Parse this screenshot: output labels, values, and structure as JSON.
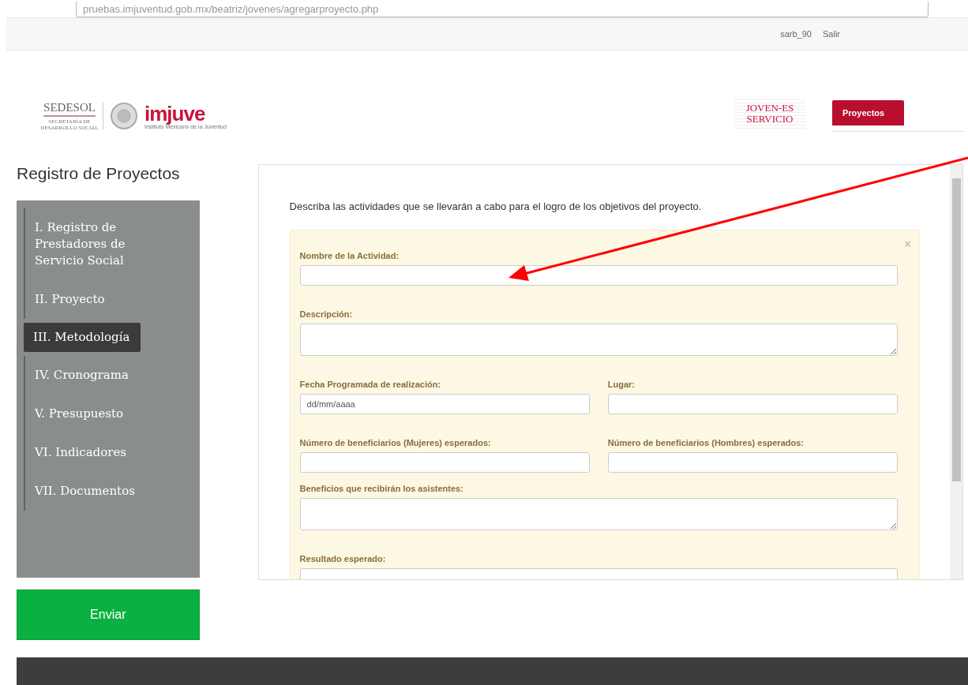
{
  "browser": {
    "url": "pruebas.imjuventud.gob.mx/beatriz/jovenes/agregarproyecto.php"
  },
  "topbar": {
    "user": "sarb_90",
    "logout": "Salir"
  },
  "header": {
    "sedesol": "SEDESOL",
    "sedesol_sub": "SECRETARÍA DE DESARROLLO SOCIAL",
    "imjuve": "imjuve",
    "imjuve_sub": "Instituto Mexicano de la Juventud",
    "joven": [
      "JOVEN-ES",
      "SERVICIO"
    ],
    "nav": [
      {
        "label": "Proyectos",
        "selected": true
      }
    ]
  },
  "page_title": "Registro de Proyectos",
  "sidebar": {
    "items": [
      {
        "label": "I. Registro de Prestadores de Servicio Social",
        "selected": false
      },
      {
        "label": "II. Proyecto",
        "selected": false
      },
      {
        "label": "III. Metodología",
        "selected": true
      },
      {
        "label": "IV. Cronograma",
        "selected": false
      },
      {
        "label": "V. Presupuesto",
        "selected": false
      },
      {
        "label": "VI. Indicadores",
        "selected": false
      },
      {
        "label": "VII. Documentos",
        "selected": false
      }
    ]
  },
  "submit": "Enviar",
  "form": {
    "intro": "Describa las actividades que se llevarán a cabo para el logro de los objetivos del proyecto.",
    "close": "×",
    "rows": [
      {
        "fields": [
          {
            "label": "Nombre de la Actividad:",
            "kind": "input"
          }
        ]
      },
      {
        "fields": [
          {
            "label": "Descripción:",
            "kind": "textarea"
          }
        ]
      },
      {
        "fields": [
          {
            "label": "Fecha Programada de realización:",
            "kind": "input",
            "placeholder": "dd/mm/aaaa"
          },
          {
            "label": "Lugar:",
            "kind": "input"
          }
        ]
      },
      {
        "fields": [
          {
            "label": "Número de beneficiarios (Mujeres) esperados:",
            "kind": "input"
          },
          {
            "label": "Número de beneficiarios (Hombres) esperados:",
            "kind": "input"
          }
        ]
      },
      {
        "fields": [
          {
            "label": "Beneficios que recibirán los asistentes:",
            "kind": "textarea"
          }
        ]
      },
      {
        "fields": [
          {
            "label": "Resultado esperado:",
            "kind": "input"
          }
        ]
      }
    ]
  }
}
